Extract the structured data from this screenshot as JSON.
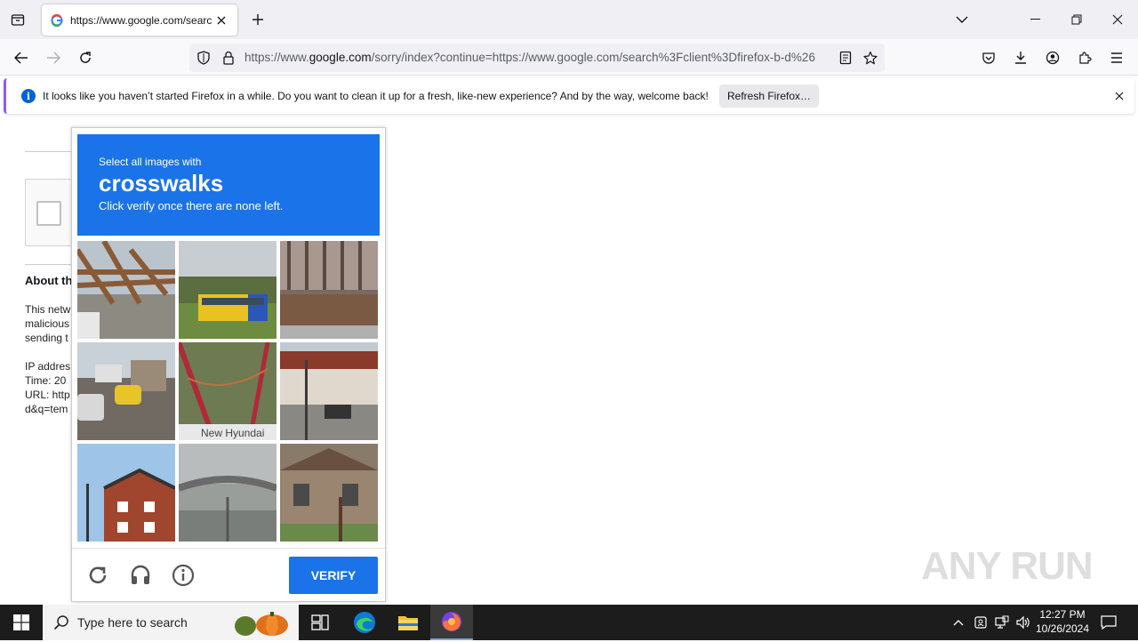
{
  "browser": {
    "tab": {
      "title": "https://www.google.com/search",
      "favicon": "google-g-icon"
    },
    "url": {
      "prefix": "https://www.",
      "host": "google.com",
      "rest": "/sorry/index?continue=https://www.google.com/search%3Fclient%3Dfirefox-b-d%26"
    }
  },
  "notification": {
    "message": "It looks like you haven’t started Firefox in a while. Do you want to clean it up for a fresh, like-new experience? And by the way, welcome back!",
    "button": "Refresh Firefox…"
  },
  "page": {
    "about_heading": "About th",
    "paragraph1": [
      "This netw",
      "malicious",
      "sending t"
    ],
    "paragraph2": [
      "IP addres",
      "Time: 20",
      "URL: http",
      "d&q=tem"
    ]
  },
  "captcha": {
    "instruction_small": "Select all images with",
    "target": "crosswalks",
    "instruction_sub": "Click verify once there are none left.",
    "tile_caption": "New Hyundai",
    "verify_label": "VERIFY"
  },
  "watermark": "ANY RUN",
  "taskbar": {
    "search_placeholder": "Type here to search",
    "time": "12:27 PM",
    "date": "10/26/2024"
  },
  "colors": {
    "accent": "#1a73e8",
    "firefox_notification_stripe": "#9059ff",
    "taskbar": "#1c1c1c"
  }
}
